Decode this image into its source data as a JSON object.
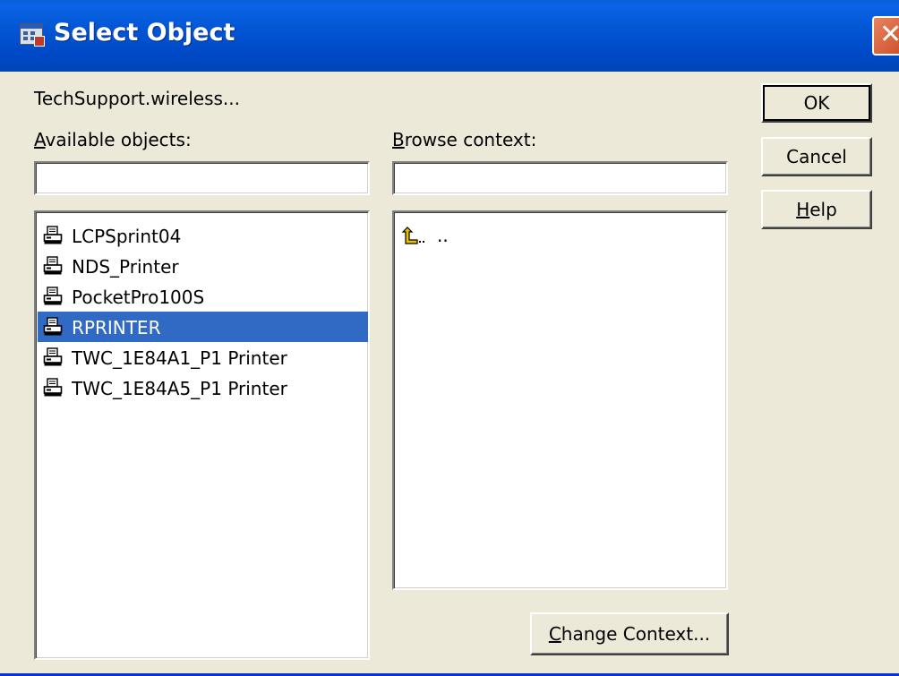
{
  "window": {
    "title": "Select Object",
    "close_glyph": "✕"
  },
  "header": {
    "current_context": "TechSupport.wireless..."
  },
  "available_objects": {
    "label_mnemonic": "A",
    "label_rest": "vailable objects:",
    "filter_value": "",
    "items": [
      {
        "label": "LCPSprint04",
        "icon": "printer-icon",
        "selected": false
      },
      {
        "label": "NDS_Printer",
        "icon": "printer-icon",
        "selected": false
      },
      {
        "label": "PocketPro100S",
        "icon": "printer-icon",
        "selected": false
      },
      {
        "label": "RPRINTER",
        "icon": "printer-icon",
        "selected": true
      },
      {
        "label": "TWC_1E84A1_P1 Printer",
        "icon": "printer-icon",
        "selected": false
      },
      {
        "label": "TWC_1E84A5_P1 Printer",
        "icon": "printer-icon",
        "selected": false
      }
    ]
  },
  "browse_context": {
    "label_mnemonic": "B",
    "label_rest": "rowse context:",
    "filter_value": "",
    "items": [
      {
        "label": "..",
        "icon": "up-level-icon"
      }
    ]
  },
  "buttons": {
    "ok": "OK",
    "cancel": "Cancel",
    "help_mnemonic": "H",
    "help_rest": "elp",
    "change_context_mnemonic": "C",
    "change_context_rest": "hange Context..."
  },
  "colors": {
    "selection": "#316ac5",
    "titlebar": "#0055e5",
    "dialog_bg": "#ece9d8"
  }
}
